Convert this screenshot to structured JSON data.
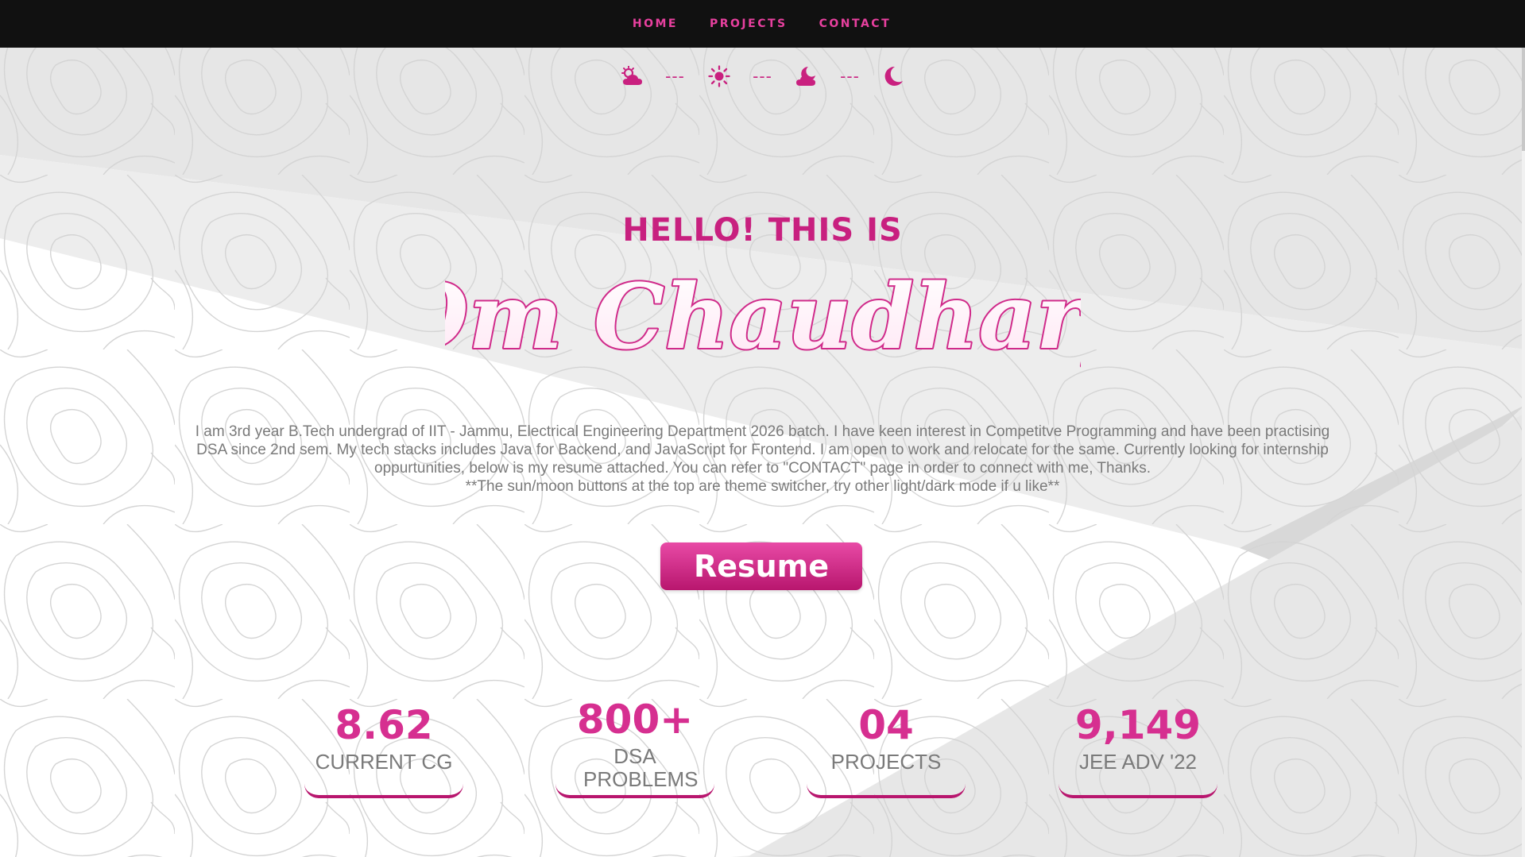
{
  "nav": {
    "items": [
      {
        "label": "HOME"
      },
      {
        "label": "PROJECTS"
      },
      {
        "label": "CONTACT"
      }
    ]
  },
  "theme_switcher": {
    "icons": [
      "cloud-sun-icon",
      "sun-icon",
      "cloud-moon-icon",
      "moon-icon"
    ],
    "separator": "---"
  },
  "hero": {
    "greeting": "HELLO! THIS IS",
    "name": "Om Chaudhary",
    "intro_lines": [
      "I am 3rd year B.Tech undergrad of IIT - Jammu, Electrical Engineering Department 2026 batch. I have keen interest in Competitve Programming and have been practising",
      "DSA since 2nd sem. My tech stacks includes Java for Backend, and JavaScript for Frontend. I am open to work and relocate for the same. Currently looking for internship",
      "oppurtunities, below is my resume attached. You can refer to \"CONTACT\" page in order to connect with me, Thanks.",
      "**The sun/moon buttons at the top are theme switcher, try other light/dark mode if u like**"
    ],
    "resume_label": "Resume"
  },
  "stats": [
    {
      "value": "8.62",
      "label": "CURRENT CG"
    },
    {
      "value": "800+",
      "label": "DSA PROBLEMS"
    },
    {
      "value": "04",
      "label": "PROJECTS"
    },
    {
      "value": "9,149",
      "label": "JEE ADV '22"
    }
  ],
  "colors": {
    "accent": "#e8409f",
    "accent_dark": "#b8166e",
    "nav_bg": "#111111",
    "text_gray": "#7a7a7a"
  }
}
